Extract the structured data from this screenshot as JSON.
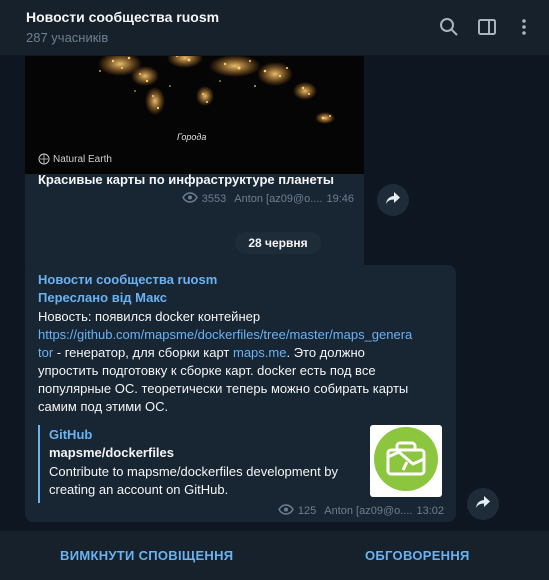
{
  "header": {
    "title": "Новости сообщества ruosm",
    "subtitle": "287 учасників",
    "icons": [
      "search-icon",
      "sidebar-toggle-icon",
      "more-vertical-icon"
    ]
  },
  "messages": [
    {
      "image_caption": "Города",
      "image_logo": "Natural Earth",
      "text": "Красивые карты по инфраструктуре планеты",
      "views": "3553",
      "author": "Anton [az09@o....",
      "time": "19:46"
    },
    {
      "source": "Новости сообщества ruosm",
      "forwarded": "Переслано від Макс",
      "lines": [
        "Новость: появился docker контейнер",
        "https://github.com/mapsme/dockerfiles/tree/master/maps_genera",
        " - генератор, для сборки карт ",
        "maps.me",
        ".  Это должно",
        "упростить подготовку к сборке карт. docker есть под все",
        "популярные ОС. теоретически теперь можно собирать карты",
        "самим под этими ОС."
      ],
      "link_tail": "tor",
      "preview": {
        "site": "GitHub",
        "title": "mapsme/dockerfiles",
        "description": "Contribute to mapsme/dockerfiles development by creating an account on GitHub."
      },
      "views": "125",
      "author": "Anton [az09@o....",
      "time": "13:02"
    }
  ],
  "date_separator": "28 червня",
  "footer": {
    "mute_label": "ВИМКНУТИ СПОВІЩЕННЯ",
    "discuss_label": "ОБГОВОРЕННЯ"
  },
  "colors": {
    "background": "#0e1621",
    "panel": "#17212b",
    "bubble": "#182533",
    "accent": "#6ab2f2",
    "muted": "#6d7f8f",
    "preview_icon": "#8cc63e"
  }
}
